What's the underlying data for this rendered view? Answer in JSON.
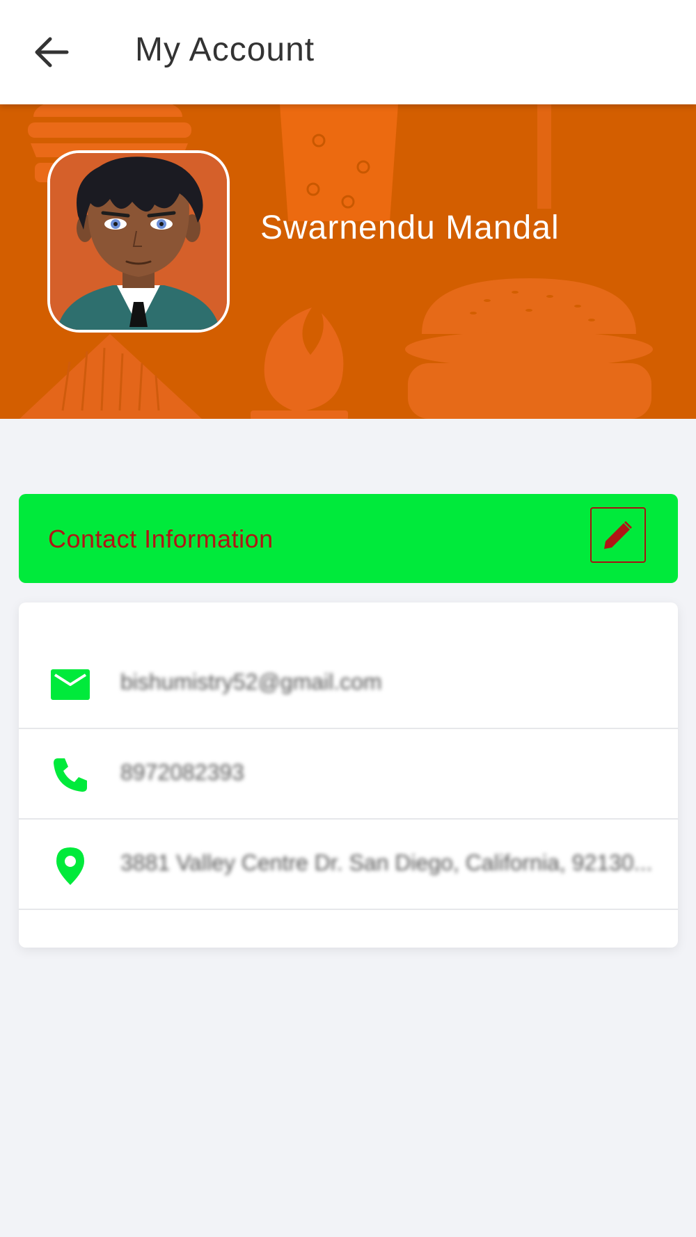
{
  "header": {
    "title": "My Account",
    "back_icon": "arrow-left-icon"
  },
  "profile": {
    "name": "Swarnendu Mandal",
    "avatar": "cartoon-avatar-man-in-suit"
  },
  "contact": {
    "section_title": "Contact Information",
    "edit_icon": "pencil-icon",
    "email": "bishumistry52@gmail.com",
    "phone": "8972082393",
    "address": "3881 Valley Centre Dr. San Diego, California, 92130..."
  },
  "colors": {
    "hero": "#d35e00",
    "accent_green": "#00ea3b",
    "accent_red": "#b01515",
    "background": "#f2f3f7"
  }
}
